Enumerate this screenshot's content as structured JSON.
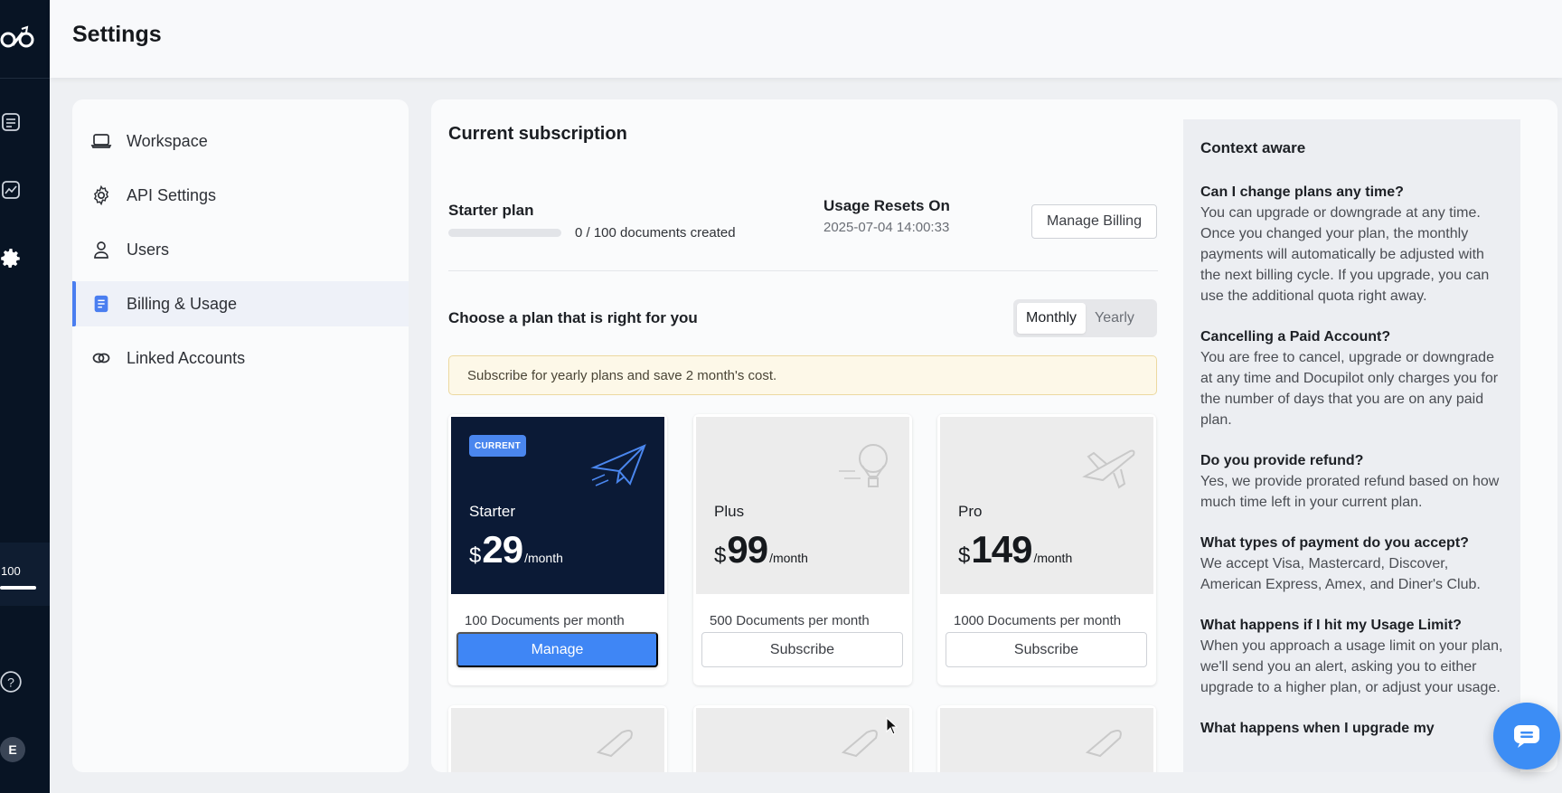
{
  "header": {
    "title": "Settings"
  },
  "rail": {
    "usage_count": "100",
    "avatar_initial": "E"
  },
  "nav": {
    "items": [
      {
        "label": "Workspace",
        "icon": "laptop-icon"
      },
      {
        "label": "API Settings",
        "icon": "gear-icon"
      },
      {
        "label": "Users",
        "icon": "user-icon"
      },
      {
        "label": "Billing & Usage",
        "icon": "document-icon",
        "active": true
      },
      {
        "label": "Linked Accounts",
        "icon": "link-icon"
      }
    ]
  },
  "subscription": {
    "title": "Current subscription",
    "plan_name": "Starter plan",
    "usage_fraction": 0.0,
    "usage_text": "0 / 100 documents created",
    "reset_label": "Usage Resets On",
    "reset_date": "2025-07-04 14:00:33",
    "manage_billing": "Manage Billing"
  },
  "plans": {
    "heading": "Choose a plan that is right for you",
    "toggle": {
      "monthly": "Monthly",
      "yearly": "Yearly",
      "selected": "monthly"
    },
    "notice": "Subscribe for yearly plans and save 2 month's cost.",
    "cards": [
      {
        "badge": "CURRENT",
        "name": "Starter",
        "currency": "$",
        "amount": "29",
        "period": "/month",
        "docs": "100 Documents per month",
        "button": "Manage",
        "icon": "paper-plane-icon"
      },
      {
        "name": "Plus",
        "currency": "$",
        "amount": "99",
        "period": "/month",
        "docs": "500 Documents per month",
        "button": "Subscribe",
        "icon": "hot-air-balloon-icon"
      },
      {
        "name": "Pro",
        "currency": "$",
        "amount": "149",
        "period": "/month",
        "docs": "1000 Documents per month",
        "button": "Subscribe",
        "icon": "airplane-icon"
      }
    ]
  },
  "context": {
    "title": "Context aware",
    "faqs": [
      {
        "q": "Can I change plans any time?",
        "a": "You can upgrade or downgrade at any time. Once you changed your plan, the monthly payments will automatically be adjusted with the next billing cycle. If you upgrade, you can use the additional quota right away."
      },
      {
        "q": "Cancelling a Paid Account?",
        "a": "You are free to cancel, upgrade or downgrade at any time and Docupilot only charges you for the number of days that you are on any paid plan."
      },
      {
        "q": "Do you provide refund?",
        "a": "Yes, we provide prorated refund based on how much time left in your current plan."
      },
      {
        "q": "What types of payment do you accept?",
        "a": "We accept Visa, Mastercard, Discover, American Express, Amex, and Diner's Club."
      },
      {
        "q": "What happens if I hit my Usage Limit?",
        "a": "When you approach a usage limit on your plan, we'll send you an alert, asking you to either upgrade to a higher plan, or adjust your usage."
      },
      {
        "q": "What happens when I upgrade my",
        "a": ""
      }
    ]
  },
  "colors": {
    "rail": "#081424",
    "accent": "#4a7ef0",
    "primary_button": "#3f86f5",
    "current_card": "#0b1a36"
  }
}
